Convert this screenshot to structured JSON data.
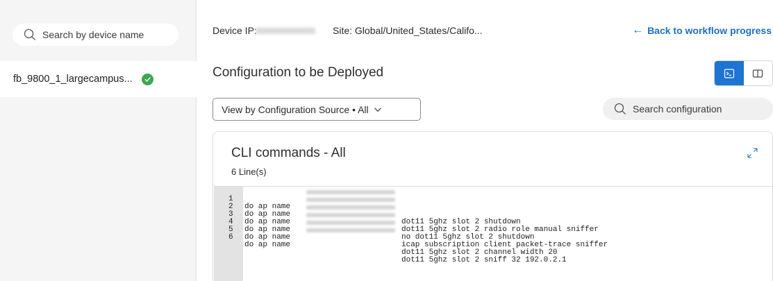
{
  "sidebar": {
    "search": {
      "placeholder": "Search by device name",
      "icon": "search-icon"
    },
    "devices": [
      {
        "name": "fb_9800_1_largecampus...",
        "status": "success",
        "status_color": "#3aa84f"
      }
    ]
  },
  "header": {
    "device_ip_label": "Device IP:",
    "site": "Site: Global/United_States/Califo...",
    "back_link": "Back to workflow progress",
    "back_arrow": "←",
    "accent_color": "#1e74d2"
  },
  "main": {
    "title": "Configuration to be Deployed",
    "view_toggle": [
      {
        "name": "terminal-view",
        "icon": "terminal-icon",
        "active": true
      },
      {
        "name": "split-view",
        "icon": "split-view-icon",
        "active": false
      }
    ],
    "source_filter": {
      "label": "View by Configuration Source • All"
    },
    "config_search": {
      "placeholder": "Search configuration"
    }
  },
  "cli": {
    "title": "CLI commands - All",
    "line_count": "6 Line(s)",
    "lines": [
      {
        "num": "1",
        "prefix": "do ap name",
        "command": "dot11 5ghz slot 2 shutdown"
      },
      {
        "num": "2",
        "prefix": "do ap name",
        "command": "dot11 5ghz slot 2 radio role manual sniffer"
      },
      {
        "num": "3",
        "prefix": "do ap name",
        "command": "no dot11 5ghz slot 2 shutdown"
      },
      {
        "num": "4",
        "prefix": "do ap name",
        "command": "icap subscription client packet-trace sniffer"
      },
      {
        "num": "5",
        "prefix": "do ap name",
        "command": "dot11 5ghz slot 2 channel width 20"
      },
      {
        "num": "6",
        "prefix": "do ap name",
        "command": "dot11 5ghz slot 2 sniff 32 192.0.2.1"
      }
    ]
  }
}
